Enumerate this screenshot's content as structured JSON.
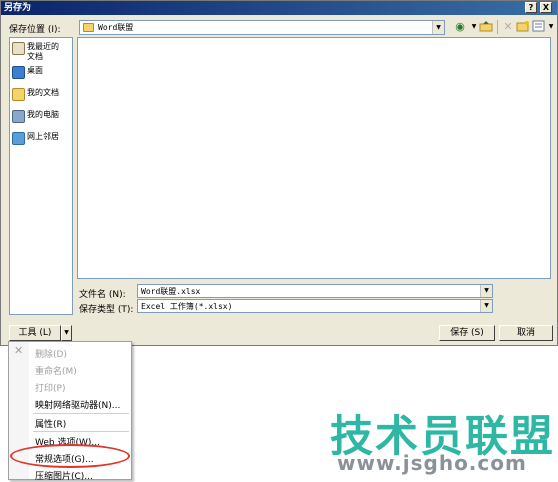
{
  "window": {
    "title": "另存为",
    "help_glyph": "?",
    "close_glyph": "X"
  },
  "location": {
    "label": "保存位置 (I):",
    "value": "Word联盟"
  },
  "places": [
    {
      "label": "我最近的\n文档",
      "icon": "recent-docs-icon"
    },
    {
      "label": "桌面",
      "icon": "desktop-icon"
    },
    {
      "label": "我的文档",
      "icon": "my-documents-icon"
    },
    {
      "label": "我的电脑",
      "icon": "my-computer-icon"
    },
    {
      "label": "网上邻居",
      "icon": "network-places-icon"
    }
  ],
  "filename": {
    "label": "文件名 (N):",
    "value": "Word联盟.xlsx"
  },
  "filetype": {
    "label": "保存类型 (T):",
    "value": "Excel 工作簿(*.xlsx)"
  },
  "buttons": {
    "tools": "工具 (L)",
    "save": "保存 (S)",
    "cancel": "取消"
  },
  "tools_menu": {
    "items": [
      {
        "label": "删除(D)",
        "disabled": true
      },
      {
        "label": "重命名(M)",
        "disabled": true
      },
      {
        "label": "打印(P)",
        "disabled": true
      },
      {
        "label": "映射网络驱动器(N)...",
        "disabled": false
      },
      {
        "label": "属性(R)",
        "disabled": false
      },
      {
        "label": "Web 选项(W)...",
        "disabled": false
      },
      {
        "label": "常规选项(G)...",
        "disabled": false,
        "highlighted": true
      },
      {
        "label": "压缩图片(C)...",
        "disabled": false
      }
    ]
  },
  "watermark": {
    "cn": "技术员联盟",
    "url": "www.jsgho.com"
  },
  "colors": {
    "title_bar": "#0a246a",
    "dialog_bg": "#ece9d8",
    "watermark_teal": "#2fb7a6",
    "highlight_oval": "#e0352b"
  }
}
